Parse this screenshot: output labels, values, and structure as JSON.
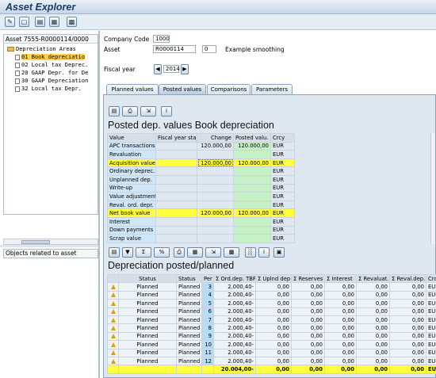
{
  "app": {
    "title": "Asset Explorer"
  },
  "left": {
    "header": "Asset 7555-R0000114/0000",
    "tree": [
      {
        "label": "Depreciation Areas",
        "kind": "folder"
      },
      {
        "label": "01 Book depreciatio",
        "kind": "item",
        "selected": true
      },
      {
        "label": "02 Local tax Deprec.",
        "kind": "item"
      },
      {
        "label": "20 GAAP Depr. for De",
        "kind": "item"
      },
      {
        "label": "30 GAAP Depreciation",
        "kind": "item"
      },
      {
        "label": "32 Local tax  Depr.",
        "kind": "item"
      }
    ],
    "related_label": "Objects related to asset"
  },
  "header": {
    "company_code_label": "Company Code",
    "company_code": "1000",
    "asset_label": "Asset",
    "asset_no": "R0000114",
    "asset_sub": "0",
    "asset_desc": "Example smoothing",
    "fiscal_year_label": "Fiscal year",
    "fiscal_year": "2014"
  },
  "tabs": [
    "Planned values",
    "Posted values",
    "Comparisons",
    "Parameters"
  ],
  "posted": {
    "title": "Posted dep. values Book depreciation",
    "columns": [
      "Value",
      "Fiscal year sta_",
      "Change",
      "Posted valu.",
      "Crcy"
    ],
    "rows": [
      {
        "label": "APC transactions",
        "fy": "",
        "change": "120.000,00",
        "posted": "120.000,00",
        "crcy": "EUR",
        "hl": false
      },
      {
        "label": "Revaluation",
        "fy": "",
        "change": "",
        "posted": "",
        "crcy": "EUR",
        "hl": false
      },
      {
        "label": "Acquisition value",
        "fy": "",
        "change": "120.000,00",
        "posted": "120.000,00",
        "crcy": "EUR",
        "hl": true
      },
      {
        "label": "Ordinary deprec.",
        "fy": "",
        "change": "",
        "posted": "",
        "crcy": "EUR",
        "hl": false
      },
      {
        "label": "Unplanned dep.",
        "fy": "",
        "change": "",
        "posted": "",
        "crcy": "EUR",
        "hl": false
      },
      {
        "label": "Write-up",
        "fy": "",
        "change": "",
        "posted": "",
        "crcy": "EUR",
        "hl": false
      },
      {
        "label": "Value adjustment",
        "fy": "",
        "change": "",
        "posted": "",
        "crcy": "EUR",
        "hl": false
      },
      {
        "label": "Reval. ord. depr.",
        "fy": "",
        "change": "",
        "posted": "",
        "crcy": "EUR",
        "hl": false
      },
      {
        "label": "Net book value",
        "fy": "",
        "change": "120.000,00",
        "posted": "120.000,00",
        "crcy": "EUR",
        "hl": true
      },
      {
        "label": "Interest",
        "fy": "",
        "change": "",
        "posted": "",
        "crcy": "EUR",
        "hl": false
      },
      {
        "label": "Down payments",
        "fy": "",
        "change": "",
        "posted": "",
        "crcy": "EUR",
        "hl": false
      },
      {
        "label": "Scrap value",
        "fy": "",
        "change": "",
        "posted": "",
        "crcy": "EUR",
        "hl": false
      }
    ]
  },
  "dep": {
    "title": "Depreciation posted/planned",
    "columns": [
      "",
      "Status",
      "Status",
      "Per",
      "Σ Ord.dep. TBP",
      "Σ Uplnd dep.",
      "Σ Reserves",
      "Σ Interest",
      "Σ Revaluat.",
      "Σ Reval.dep.",
      "Crcy"
    ],
    "rows": [
      {
        "status": "Planned",
        "status2": "Planned",
        "per": "3",
        "ord": "2.000,40-",
        "upl": "0,00",
        "res": "0,00",
        "int": "0,00",
        "rev": "0,00",
        "revd": "0,00",
        "crcy": "EUR"
      },
      {
        "status": "Planned",
        "status2": "Planned",
        "per": "4",
        "ord": "2.000,40-",
        "upl": "0,00",
        "res": "0,00",
        "int": "0,00",
        "rev": "0,00",
        "revd": "0,00",
        "crcy": "EUR"
      },
      {
        "status": "Planned",
        "status2": "Planned",
        "per": "5",
        "ord": "2.000,40-",
        "upl": "0,00",
        "res": "0,00",
        "int": "0,00",
        "rev": "0,00",
        "revd": "0,00",
        "crcy": "EUR"
      },
      {
        "status": "Planned",
        "status2": "Planned",
        "per": "6",
        "ord": "2.000,40-",
        "upl": "0,00",
        "res": "0,00",
        "int": "0,00",
        "rev": "0,00",
        "revd": "0,00",
        "crcy": "EUR"
      },
      {
        "status": "Planned",
        "status2": "Planned",
        "per": "7",
        "ord": "2.000,40-",
        "upl": "0,00",
        "res": "0,00",
        "int": "0,00",
        "rev": "0,00",
        "revd": "0,00",
        "crcy": "EUR"
      },
      {
        "status": "Planned",
        "status2": "Planned",
        "per": "8",
        "ord": "2.000,40-",
        "upl": "0,00",
        "res": "0,00",
        "int": "0,00",
        "rev": "0,00",
        "revd": "0,00",
        "crcy": "EUR"
      },
      {
        "status": "Planned",
        "status2": "Planned",
        "per": "9",
        "ord": "2.000,40-",
        "upl": "0,00",
        "res": "0,00",
        "int": "0,00",
        "rev": "0,00",
        "revd": "0,00",
        "crcy": "EUR"
      },
      {
        "status": "Planned",
        "status2": "Planned",
        "per": "10",
        "ord": "2.000,40-",
        "upl": "0,00",
        "res": "0,00",
        "int": "0,00",
        "rev": "0,00",
        "revd": "0,00",
        "crcy": "EUR"
      },
      {
        "status": "Planned",
        "status2": "Planned",
        "per": "11",
        "ord": "2.000,40-",
        "upl": "0,00",
        "res": "0,00",
        "int": "0,00",
        "rev": "0,00",
        "revd": "0,00",
        "crcy": "EUR"
      },
      {
        "status": "Planned",
        "status2": "Planned",
        "per": "12",
        "ord": "2.000,40-",
        "upl": "0,00",
        "res": "0,00",
        "int": "0,00",
        "rev": "0,00",
        "revd": "0,00",
        "crcy": "EUR"
      }
    ],
    "total": {
      "ord": "20.004,00-",
      "upl": "0,00",
      "res": "0,00",
      "int": "0,00",
      "rev": "0,00",
      "revd": "0,00",
      "crcy": "EUR"
    }
  },
  "colors": {
    "highlight": "#ffff40",
    "posted_col": "#c6f0c6",
    "label_col": "#cfe6f8",
    "warning": "#e0a000"
  }
}
